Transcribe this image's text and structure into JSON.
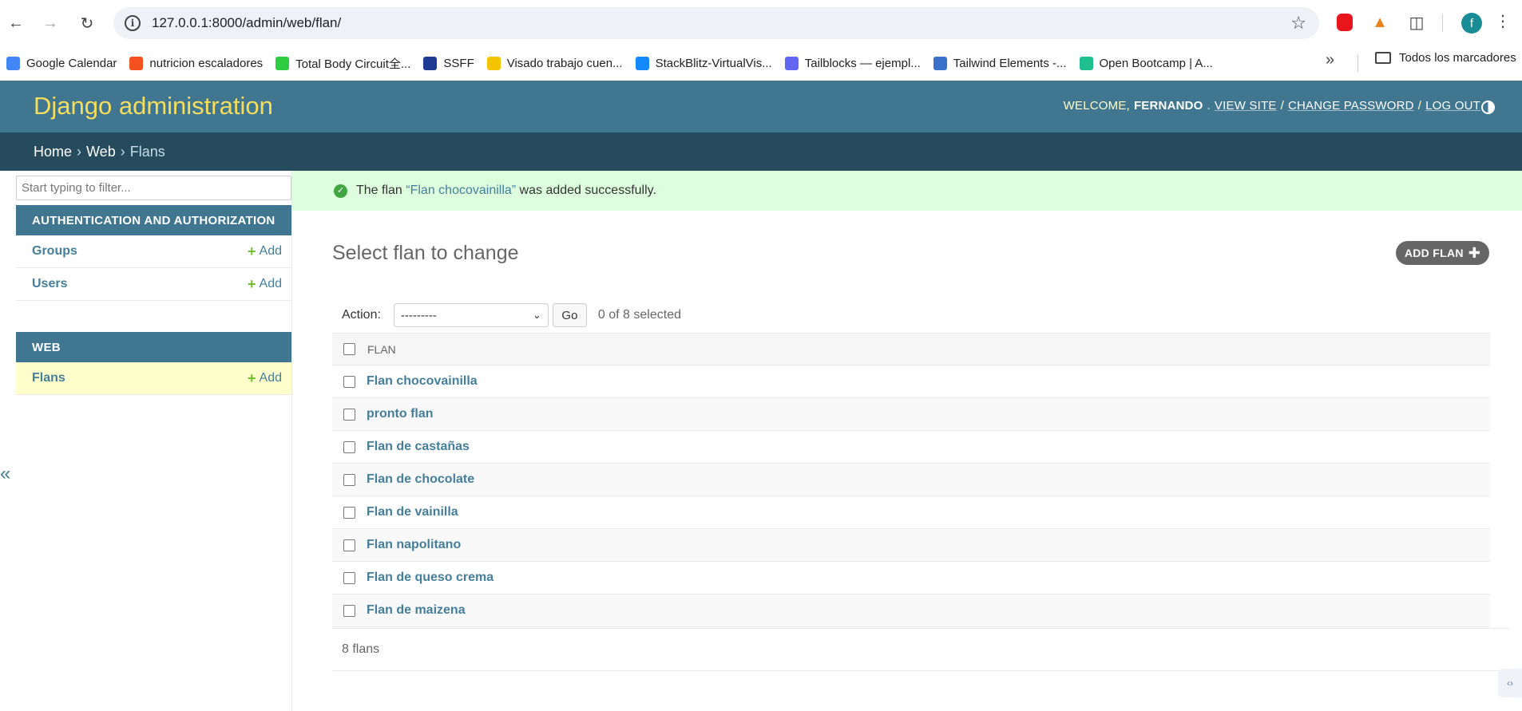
{
  "browser": {
    "url": "127.0.0.1:8000/admin/web/flan/",
    "avatar_letter": "f",
    "bookmarks": [
      {
        "label": "Google Calendar",
        "color": "#4285f4"
      },
      {
        "label": "nutricion escaladores",
        "color": "#f4511e"
      },
      {
        "label": "Total Body Circuit全...",
        "color": "#2ecc40"
      },
      {
        "label": "SSFF",
        "color": "#1f3a93"
      },
      {
        "label": "Visado trabajo cuen...",
        "color": "#f5c400"
      },
      {
        "label": "StackBlitz-VirtualVis...",
        "color": "#1389fd"
      },
      {
        "label": "Tailblocks — ejempl...",
        "color": "#6366f1"
      },
      {
        "label": "Tailwind Elements -...",
        "color": "#3b71ca"
      },
      {
        "label": "Open Bootcamp | A...",
        "color": "#1fbf8f"
      }
    ],
    "all_bookmarks": "Todos los marcadores"
  },
  "header": {
    "branding": "Django administration",
    "welcome": "WELCOME,",
    "username": "FERNANDO",
    "view_site": "VIEW SITE",
    "change_password": "CHANGE PASSWORD",
    "log_out": "LOG OUT"
  },
  "breadcrumbs": {
    "home": "Home",
    "app": "Web",
    "current": "Flans",
    "separator": "›"
  },
  "sidebar": {
    "filter_placeholder": "Start typing to filter...",
    "auth_caption": "AUTHENTICATION AND AUTHORIZATION",
    "web_caption": "WEB",
    "add_label": "Add",
    "models": {
      "groups": "Groups",
      "users": "Users",
      "flans": "Flans"
    },
    "collapse": "«"
  },
  "message": {
    "prefix": "The flan ",
    "link": "“Flan chocovainilla”",
    "suffix": " was added successfully."
  },
  "content": {
    "title": "Select flan to change",
    "add_button": "ADD FLAN",
    "action_label": "Action:",
    "action_selected": "---------",
    "go_label": "Go",
    "selected_count": "0 of 8 selected",
    "column_header": "FLAN",
    "rows": [
      "Flan chocovainilla",
      "pronto flan",
      "Flan de castañas",
      "Flan de chocolate",
      "Flan de vainilla",
      "Flan napolitano",
      "Flan de queso crema",
      "Flan de maizena"
    ],
    "paginator": "8 flans"
  },
  "colors": {
    "header_bg": "#417690",
    "breadcrumb_bg": "#264b5d",
    "branding": "#f5dd5d",
    "link": "#447e9b",
    "success_bg": "#ddffdd",
    "add_plus": "#70bf2b"
  }
}
